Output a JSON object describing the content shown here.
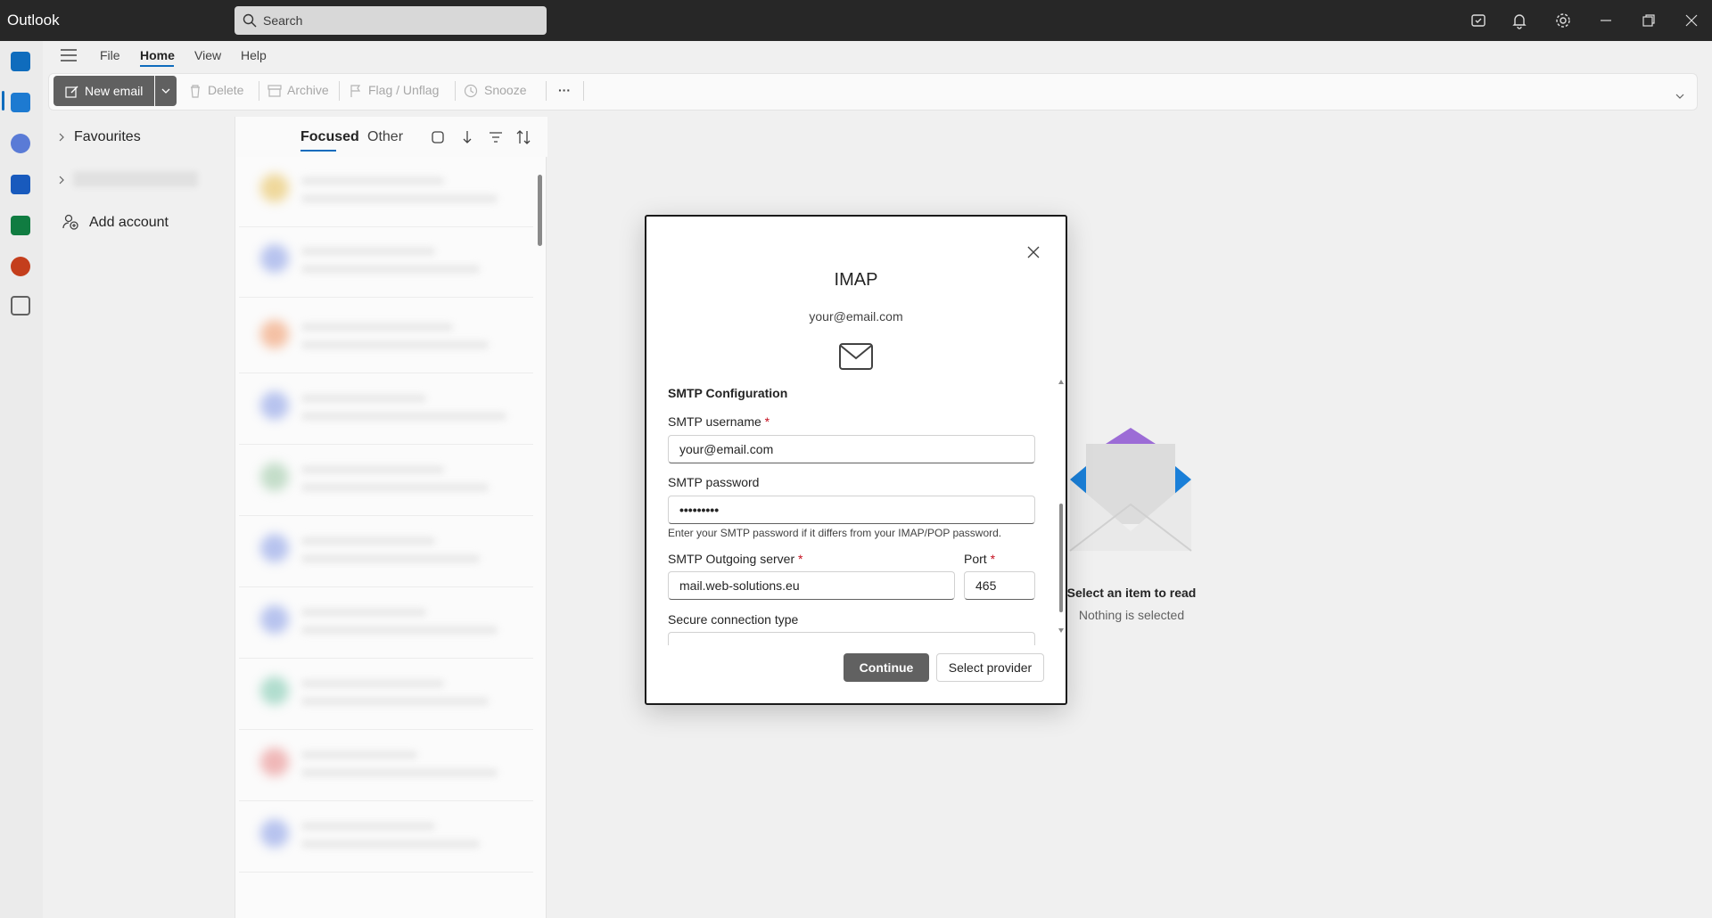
{
  "app": {
    "title": "Outlook"
  },
  "search": {
    "placeholder": "Search"
  },
  "menu": {
    "file": "File",
    "home": "Home",
    "view": "View",
    "help": "Help"
  },
  "ribbon": {
    "new_email": "New email",
    "delete": "Delete",
    "archive": "Archive",
    "flag": "Flag / Unflag",
    "snooze": "Snooze",
    "more": "···"
  },
  "folders": {
    "favourites": "Favourites",
    "add_account": "Add account"
  },
  "list": {
    "tab_focused": "Focused",
    "tab_other": "Other"
  },
  "reading_pane": {
    "title": "Select an item to read",
    "subtitle": "Nothing is selected"
  },
  "dialog": {
    "title": "IMAP",
    "email": "your@email.com",
    "section": "SMTP Configuration",
    "smtp_username_label": "SMTP username",
    "smtp_username_value": "your@email.com",
    "smtp_password_label": "SMTP password",
    "smtp_password_value": "•••••••••",
    "smtp_password_hint": "Enter your SMTP password if it differs from your IMAP/POP password.",
    "smtp_server_label": "SMTP Outgoing server",
    "smtp_server_value": "mail.web-solutions.eu",
    "port_label": "Port",
    "port_value": "465",
    "secure_label": "Secure connection type",
    "required_mark": "*",
    "continue": "Continue",
    "select_provider": "Select provider"
  },
  "colors": {
    "accent": "#0f6cbd",
    "titlebar": "#272727",
    "primary_button": "#616161",
    "required": "#c50f1f"
  }
}
